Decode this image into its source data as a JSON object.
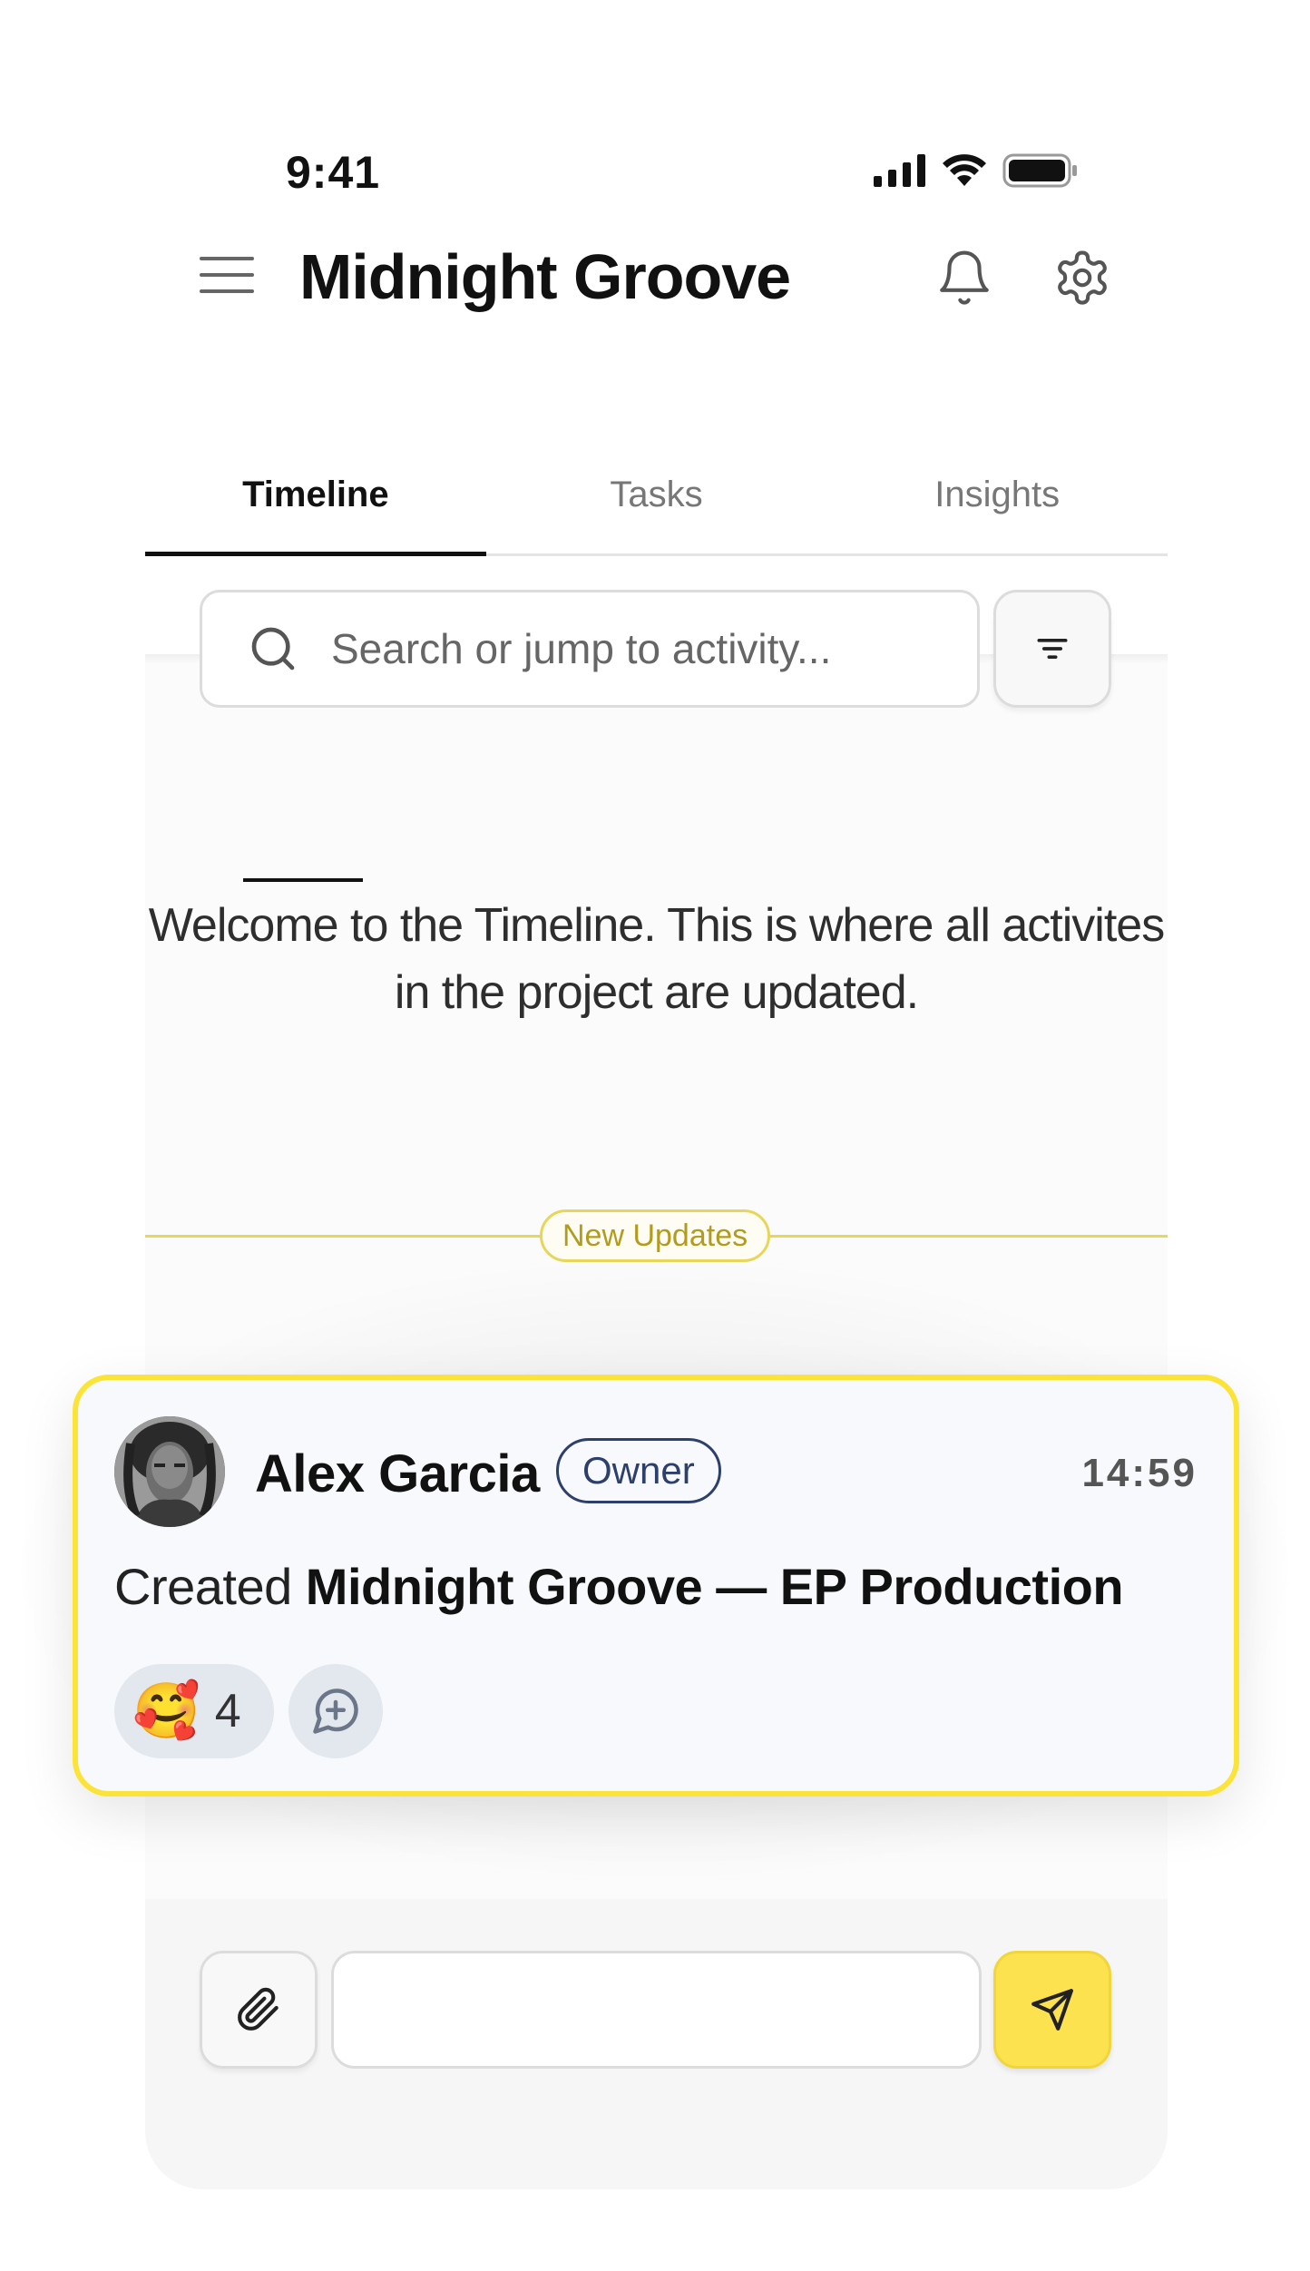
{
  "status_bar": {
    "time": "9:41"
  },
  "header": {
    "title": "Midnight Groove"
  },
  "tabs": [
    {
      "label": "Timeline",
      "active": true
    },
    {
      "label": "Tasks",
      "active": false
    },
    {
      "label": "Insights",
      "active": false
    }
  ],
  "search": {
    "placeholder": "Search or jump to activity..."
  },
  "welcome": {
    "text": "Welcome to the Timeline. This is where all activites in the project are updated."
  },
  "divider": {
    "label": "New Updates"
  },
  "activity_card": {
    "author": "Alex Garcia",
    "role": "Owner",
    "time": "14:59",
    "action_prefix": "Created",
    "action_target": "Midnight Groove — EP Production",
    "reaction": {
      "emoji": "🥰",
      "count": "4"
    }
  },
  "colors": {
    "accent_yellow": "#fce337",
    "send_button": "#fde24f",
    "badge_navy": "#2d3f6b",
    "divider_gold": "#e8d65a"
  },
  "icons": [
    "menu-icon",
    "bell-icon",
    "gear-icon",
    "search-icon",
    "filter-icon",
    "paperclip-icon",
    "send-icon",
    "add-reaction-icon",
    "signal-icon",
    "wifi-icon",
    "battery-icon"
  ]
}
